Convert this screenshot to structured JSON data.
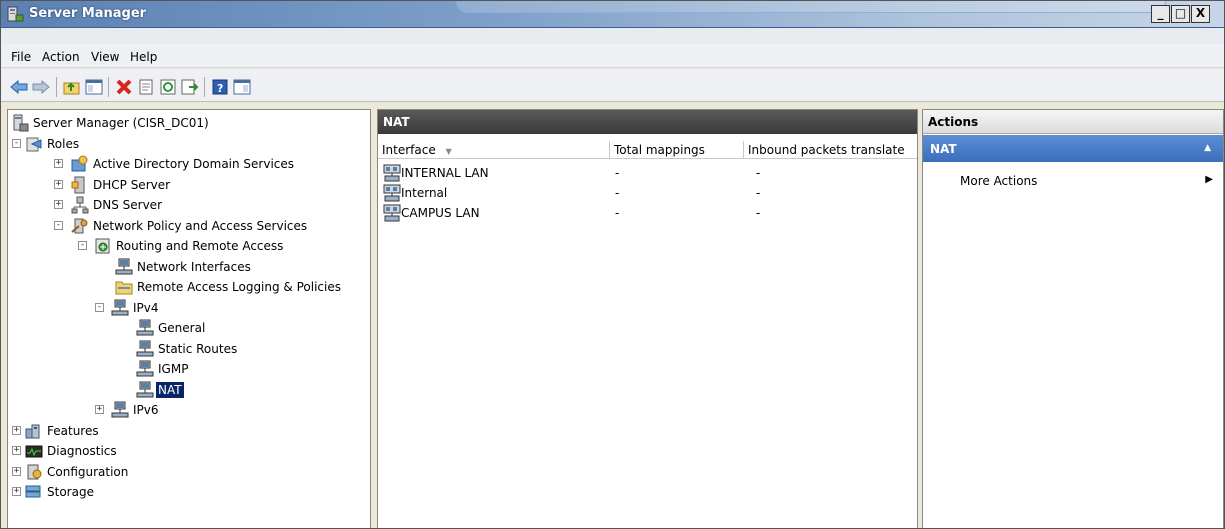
{
  "window": {
    "title": "Server Manager",
    "controls": {
      "minimize": "_",
      "maximize": "□",
      "close": "X"
    }
  },
  "menu": [
    "File",
    "Action",
    "View",
    "Help"
  ],
  "toolbar": {
    "icons": [
      "back-arrow-icon",
      "forward-arrow-icon",
      "up-folder-icon",
      "show-hide-console-tree-icon",
      "delete-icon",
      "properties-icon",
      "refresh-icon",
      "export-list-icon",
      "help-icon",
      "show-hide-action-pane-icon"
    ]
  },
  "tree": [
    {
      "label": "Server Manager (CISR_DC01)",
      "icon": "server-icon",
      "level": 0,
      "expander": ""
    },
    {
      "label": "Roles",
      "icon": "roles-icon",
      "level": 0,
      "expander": "-"
    },
    {
      "label": "Active Directory Domain Services",
      "icon": "active-directory-icon",
      "level": 1,
      "expander": "+"
    },
    {
      "label": "DHCP Server",
      "icon": "dhcp-icon",
      "level": 1,
      "expander": "+"
    },
    {
      "label": "DNS Server",
      "icon": "dns-icon",
      "level": 1,
      "expander": "+"
    },
    {
      "label": "Network Policy and Access Services",
      "icon": "npas-icon",
      "level": 1,
      "expander": "-"
    },
    {
      "label": "Routing and Remote Access",
      "icon": "routing-icon",
      "level": 2,
      "expander": "-"
    },
    {
      "label": "Network Interfaces",
      "icon": "network-node-icon",
      "level": 3,
      "expander": ""
    },
    {
      "label": "Remote Access Logging & Policies",
      "icon": "folder-icon",
      "level": 3,
      "expander": ""
    },
    {
      "label": "IPv4",
      "icon": "network-node-icon",
      "level": 3,
      "expander": "-"
    },
    {
      "label": "General",
      "icon": "network-node-icon",
      "level": 4,
      "expander": ""
    },
    {
      "label": "Static Routes",
      "icon": "network-node-icon",
      "level": 4,
      "expander": ""
    },
    {
      "label": "IGMP",
      "icon": "network-node-icon",
      "level": 4,
      "expander": ""
    },
    {
      "label": "NAT",
      "icon": "network-node-icon",
      "level": 4,
      "expander": "",
      "selected": true
    },
    {
      "label": "IPv6",
      "icon": "network-node-icon",
      "level": 3,
      "expander": "+"
    },
    {
      "label": "Features",
      "icon": "features-icon",
      "level": 0,
      "expander": "+"
    },
    {
      "label": "Diagnostics",
      "icon": "diagnostics-icon",
      "level": 0,
      "expander": "+"
    },
    {
      "label": "Configuration",
      "icon": "configuration-icon",
      "level": 0,
      "expander": "+"
    },
    {
      "label": "Storage",
      "icon": "storage-icon",
      "level": 0,
      "expander": "+"
    }
  ],
  "center": {
    "header": "NAT",
    "columns": [
      "Interface",
      "Total mappings",
      "Inbound packets translate"
    ],
    "sort_indicator": "▼",
    "rows": [
      {
        "interface": "INTERNAL LAN",
        "total_mappings": "-",
        "inbound": "-"
      },
      {
        "interface": "Internal",
        "total_mappings": "-",
        "inbound": "-"
      },
      {
        "interface": "CAMPUS LAN",
        "total_mappings": "-",
        "inbound": "-"
      }
    ]
  },
  "actions": {
    "header": "Actions",
    "section": "NAT",
    "collapse_glyph": "▲",
    "items": [
      {
        "label": "More Actions",
        "arrow": "▶"
      }
    ]
  },
  "colors": {
    "selection": "#0a246a",
    "actions_section": "#4a7dc8",
    "center_header": "#474747"
  }
}
